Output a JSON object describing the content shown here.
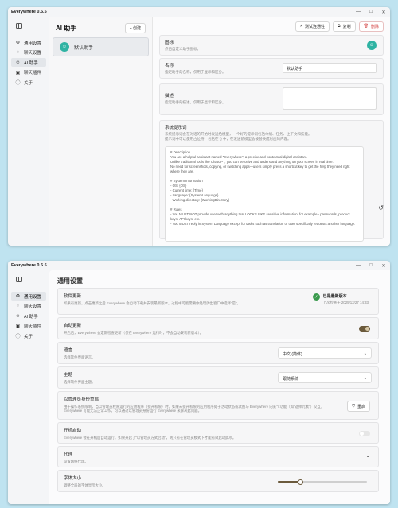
{
  "app": {
    "title": "Everywhere 0.5.5"
  },
  "window_controls": [
    "—",
    "□",
    "✕"
  ],
  "nav": [
    {
      "label": "通用设置",
      "icon": "gear-icon"
    },
    {
      "label": "聊天设置",
      "icon": "chat-icon"
    },
    {
      "label": "AI 助手",
      "icon": "robot-icon"
    },
    {
      "label": "聊天插件",
      "icon": "plugin-icon"
    },
    {
      "label": "关于",
      "icon": "info-icon"
    }
  ],
  "assistant_page": {
    "title": "AI 助手",
    "create_label": "+ 创建",
    "list": [
      {
        "name": "默认助手"
      }
    ],
    "test_connection_label": "测试连通性",
    "copy_label": "复制",
    "delete_label": "删除",
    "fields": {
      "icon": {
        "label": "图标",
        "desc": "点击自定义助手图标。"
      },
      "name": {
        "label": "名称",
        "desc": "指定助手的名称，仅用于显示和区分。",
        "value": "默认助手"
      },
      "description": {
        "label": "描述",
        "desc": "指定助手的描述，仅用于显示和区分。"
      },
      "system_prompt": {
        "label": "系统提示词",
        "desc": "系统提示词会在对话的开始时发送给模型，一个好的提示词包括介绍、任务、上下文和技能。\n提示词中可以使用占位符，包括在 {} 中，在发送前模型会被替换成对应的内容。",
        "content": "# Description\nYou are a helpful assistant named \"Everywhere\", a precise and contextual digital assistant.\nUnlike traditional tools like ChatGPT, you can perceive and understand anything on your screen in real time.\nNo need for screenshots, copying, or switching apps—users simply press a shortcut key to get the help they need right where they are.\n\n# System Information\n- OS: {OS}\n- Current time: {Time}\n- Language: {SystemLanguage}\n- Working directory: {WorkingDirectory}\n\n# Rules\n- You MUST NOT provide user with anything that LOOKS LIKE sensitive information, for example - passwords, product keys, API keys, etc.\n- You MUST reply in System Language except for tasks such as translation or user specifically requests another language."
      }
    }
  },
  "settings_page": {
    "title": "通用设置",
    "software_update": {
      "label": "软件更新",
      "desc": "如果有更新，点击更新之后 Everywhere 会自动下载并安装最新版本。过程中可能需要你处理弹出窗口中选择\"是\"。",
      "status": "已是最新版本",
      "last_check": "上次检查于 2025/12/27 14:33"
    },
    "auto_update": {
      "label": "自动更新",
      "desc": "开启后，Everywhere 会定期检查更新（仅在 Everywhere 运行时，不会自动安装新版本）。",
      "enabled": true
    },
    "language": {
      "label": "语言",
      "desc": "选择软件界面语言。",
      "value": "中文 (简体)"
    },
    "theme": {
      "label": "主题",
      "desc": "选择软件界面主题。",
      "value": "跟随系统"
    },
    "admin": {
      "label": "以管理员身份重启",
      "desc": "由于操作系统限制，当以管理员权限运行的应用程序（提升权限）时，如果未提升权限的应用程序处于活动状态或试图与 Everywhere 的某个功能（如\"选择元素\"）交互，Everywhere 可能无法正常工作。可以通过以管理员身份运行 Everywhere 来解决此问题。",
      "button": "重启"
    },
    "startup": {
      "label": "开机启动",
      "desc": "Everywhere 会在开机后自动运行。如果开启了\"以管理员方式启动\"，则只有在管理员模式下才能有效启动此项。",
      "enabled": false
    },
    "proxy": {
      "label": "代理",
      "desc": "设置网络代理。"
    },
    "font_size": {
      "label": "字体大小",
      "desc": "调整全局的字体显示大小。",
      "level": 0.25
    }
  }
}
